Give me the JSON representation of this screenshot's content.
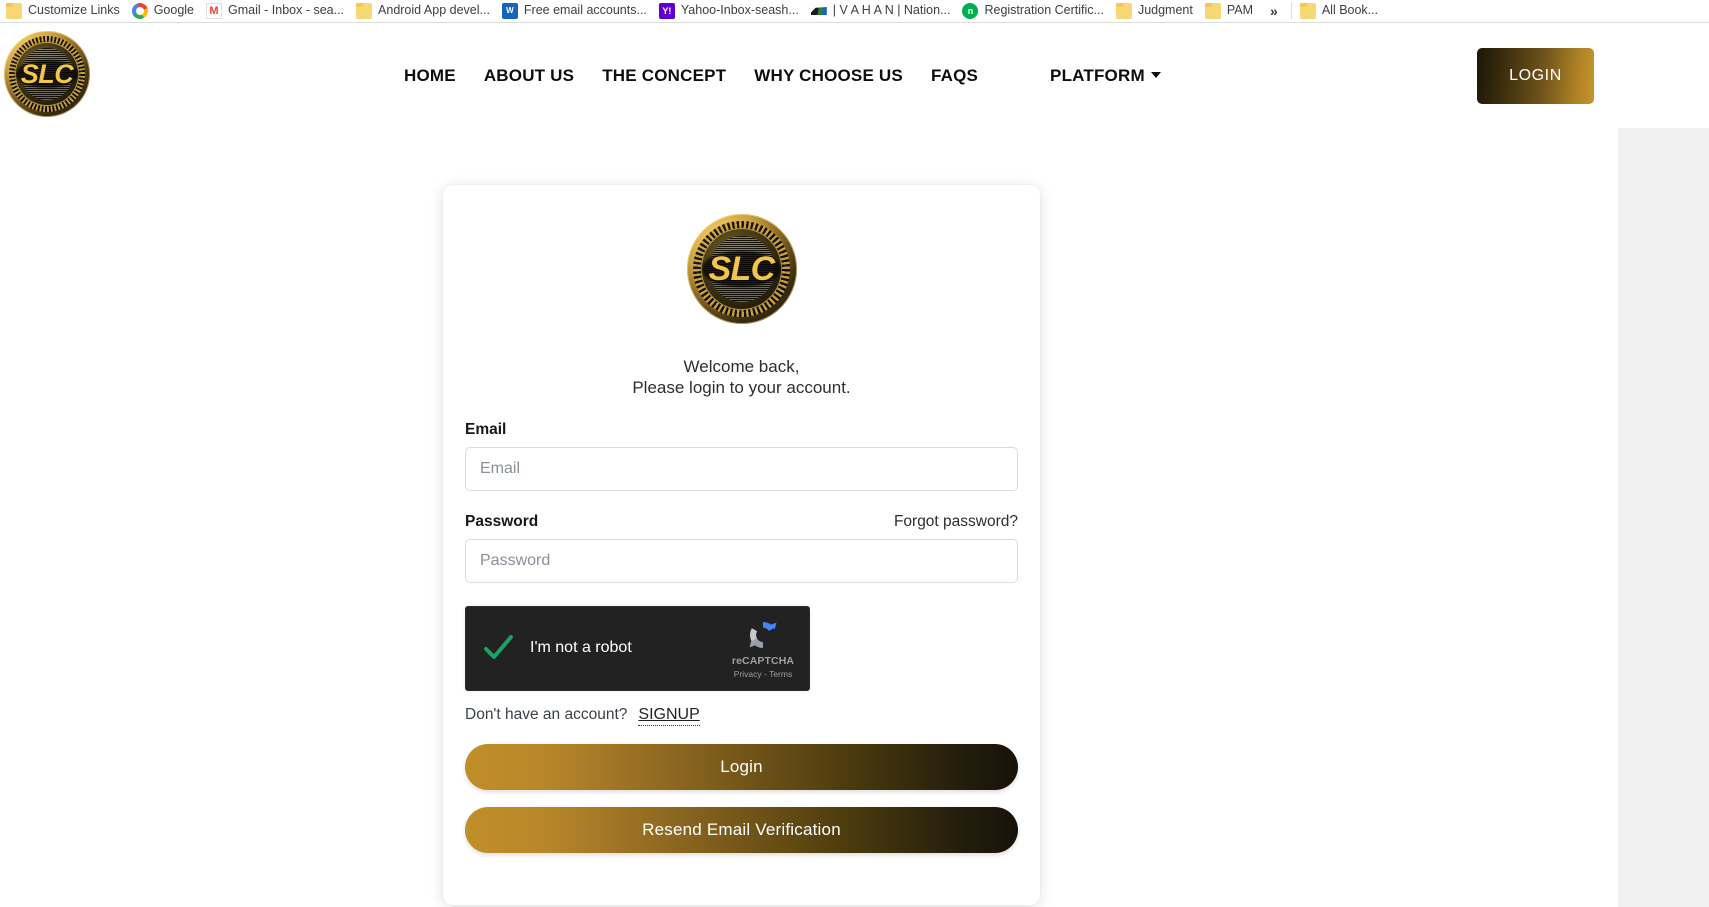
{
  "browser": {
    "bookmarks": [
      {
        "label": "Customize Links",
        "icon": "folder-icon"
      },
      {
        "label": "Google",
        "icon": "google-icon"
      },
      {
        "label": "Gmail - Inbox - sea...",
        "icon": "gmail-icon"
      },
      {
        "label": "Android App devel...",
        "icon": "folder-icon"
      },
      {
        "label": "Free email accounts...",
        "icon": "wps-icon"
      },
      {
        "label": "Yahoo-Inbox-seash...",
        "icon": "yahoo-icon"
      },
      {
        "label": "| V A H A N | Nation...",
        "icon": "vahan-icon"
      },
      {
        "label": "Registration Certific...",
        "icon": "registration-icon"
      },
      {
        "label": "Judgment",
        "icon": "folder-icon"
      },
      {
        "label": "PAM",
        "icon": "folder-icon"
      }
    ],
    "overflow_label": "»",
    "all_bookmarks": {
      "label": "All Book...",
      "icon": "folder-icon"
    }
  },
  "header": {
    "logo_text": "SLC",
    "nav": [
      {
        "label": "HOME"
      },
      {
        "label": "ABOUT US"
      },
      {
        "label": "THE CONCEPT"
      },
      {
        "label": "WHY CHOOSE US"
      },
      {
        "label": "FAQS"
      },
      {
        "label": "PLATFORM",
        "has_dropdown": true
      }
    ],
    "login_button": "LOGIN"
  },
  "card": {
    "logo_text": "SLC",
    "welcome_line1": "Welcome back,",
    "welcome_line2": "Please login to your account.",
    "email": {
      "label": "Email",
      "placeholder": "Email",
      "value": ""
    },
    "password": {
      "label": "Password",
      "placeholder": "Password",
      "value": "",
      "forgot_label": "Forgot password?"
    },
    "recaptcha": {
      "checkbox_label": "I'm not a robot",
      "brand": "reCAPTCHA",
      "legal": "Privacy - Terms",
      "checked": true
    },
    "signup_prompt": "Don't have an account?",
    "signup_link": "SIGNUP",
    "login_button": "Login",
    "resend_button": "Resend Email Verification"
  },
  "colors": {
    "gold": "#c7962c",
    "gold_dark": "#151208",
    "recaptcha_bg": "#222222",
    "check_green": "#1aa260",
    "recaptcha_blue": "#4285f4",
    "page_bg": "#ffffff",
    "gutter_bg": "#f0f0f0"
  }
}
